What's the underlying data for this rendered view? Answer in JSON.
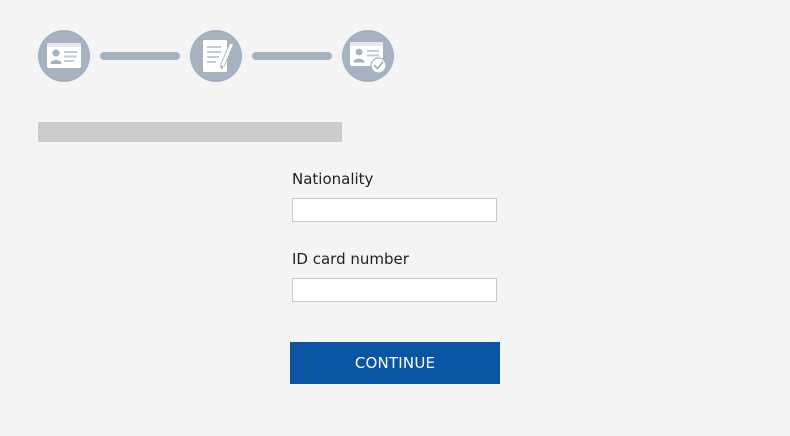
{
  "stepper": {
    "steps": [
      {
        "icon": "id-card-icon"
      },
      {
        "icon": "document-edit-icon"
      },
      {
        "icon": "id-card-check-icon"
      }
    ],
    "color": "#a7b2c1"
  },
  "form": {
    "nationality_label": "Nationality",
    "nationality_value": "",
    "id_card_label": "ID card number",
    "id_card_value": "",
    "continue_label": "CONTINUE"
  },
  "colors": {
    "background": "#f4f4f4",
    "primary_button": "#0b56a4",
    "title_placeholder": "#cccccc"
  }
}
